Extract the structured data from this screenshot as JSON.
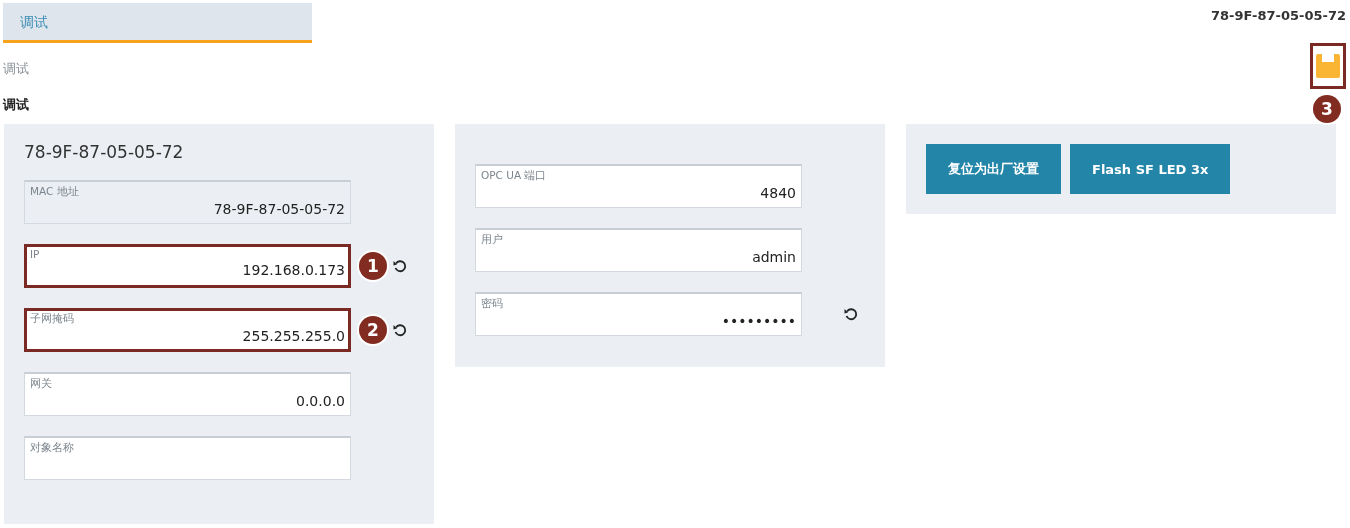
{
  "tab": {
    "label": "调试",
    "selected": true
  },
  "device_id": "78-9F-87-05-05-72",
  "breadcrumb": "调试",
  "heading": "调试",
  "save": {
    "highlighted": true,
    "callout": "3"
  },
  "panels": [
    {
      "title": "78-9F-87-05-05-72",
      "fields": [
        {
          "label": "MAC 地址",
          "value": "78-9F-87-05-05-72",
          "readonly": true,
          "highlighted": false,
          "resettable": false
        },
        {
          "label": "IP",
          "value": "192.168.0.173",
          "readonly": false,
          "highlighted": true,
          "callout": "1",
          "resettable": true
        },
        {
          "label": "子网掩码",
          "value": "255.255.255.0",
          "readonly": false,
          "highlighted": true,
          "callout": "2",
          "resettable": true
        },
        {
          "label": "网关",
          "value": "0.0.0.0",
          "readonly": false,
          "highlighted": false,
          "resettable": false
        },
        {
          "label": "对象名称",
          "readonly": false,
          "highlighted": false,
          "resettable": false
        }
      ]
    },
    {
      "fields": [
        {
          "label": "OPC UA 端口",
          "value": "4840",
          "readonly": false,
          "highlighted": false,
          "resettable": false
        },
        {
          "label": "用户",
          "value": "admin",
          "readonly": false,
          "highlighted": false,
          "resettable": false
        },
        {
          "label": "密码",
          "value": "•••••••••",
          "readonly": false,
          "highlighted": false,
          "resettable": true
        }
      ]
    },
    {
      "buttons": [
        "复位为出厂设置",
        "Flash SF LED 3x"
      ]
    }
  ]
}
